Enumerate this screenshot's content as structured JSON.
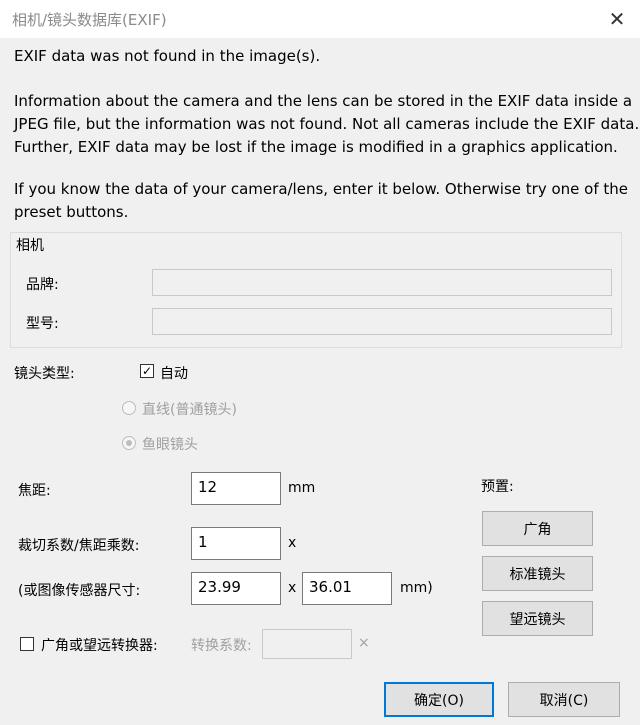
{
  "window": {
    "title": "相机/镜头数据库(EXIF)",
    "close_glyph": "✕"
  },
  "message": {
    "line1": "EXIF data was not found in the image(s).",
    "para2": [
      "Information about the camera and the lens can be stored in the EXIF data inside a",
      "JPEG file, but the information was not found. Not all cameras include the EXIF data.",
      "Further, EXIF data may be lost if the image is modified in a graphics application."
    ],
    "para3": [
      "If you know the data of your camera/lens, enter it below. Otherwise try one of the",
      "preset buttons."
    ]
  },
  "camera_group": {
    "legend": "相机",
    "brand_label": "品牌:",
    "brand_value": "",
    "model_label": "型号:",
    "model_value": ""
  },
  "lens": {
    "type_label": "镜头类型:",
    "auto_label": "自动",
    "auto_checked": true,
    "rectilinear_label": "直线(普通镜头)",
    "fisheye_label": "鱼眼镜头",
    "fisheye_selected": true
  },
  "focal": {
    "label": "焦距:",
    "value": "12",
    "unit": "mm"
  },
  "crop": {
    "label": "裁切系数/焦距乘数:",
    "value": "1",
    "unit": "x"
  },
  "sensor": {
    "label": "(或图像传感器尺寸:",
    "width": "23.99",
    "times": "x",
    "height": "36.01",
    "unit": "mm)"
  },
  "converter": {
    "checkbox_label": "广角或望远转换器:",
    "checked": false,
    "factor_label": "转换系数:",
    "factor_value": "",
    "factor_unit": "×"
  },
  "presets": {
    "label": "预置:",
    "wide": "广角",
    "standard": "标准镜头",
    "tele": "望远镜头"
  },
  "buttons": {
    "ok": "确定(O)",
    "cancel": "取消(C)"
  }
}
